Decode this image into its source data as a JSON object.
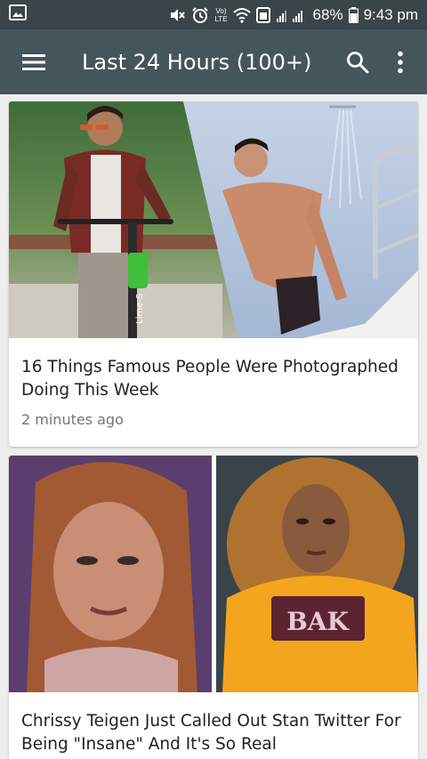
{
  "status_bar": {
    "volte": "Vo)",
    "lte": "LTE",
    "battery": "68%",
    "time": "9:43 pm",
    "icons": [
      "gallery-notification-icon",
      "mute-icon",
      "alarm-icon",
      "volte-icon",
      "wifi-icon",
      "data-icon",
      "signal-icon",
      "battery-icon"
    ]
  },
  "app_bar": {
    "title": "Last 24 Hours (100+)",
    "icons": [
      "menu-icon",
      "search-icon",
      "more-vert-icon"
    ]
  },
  "articles": [
    {
      "title": "16 Things Famous People Were Photographed Doing This Week",
      "time": "2 minutes ago",
      "scooter_brand": "Lime-S"
    },
    {
      "title": "Chrissy Teigen Just Called Out Stan Twitter For Being \"Insane\" And It's So Real",
      "shirt_text": "BAK"
    }
  ],
  "colors": {
    "status_bar": "#3a4549",
    "app_bar": "#45555c",
    "background": "#eeeeee",
    "card": "#ffffff",
    "meta_text": "#757575"
  }
}
